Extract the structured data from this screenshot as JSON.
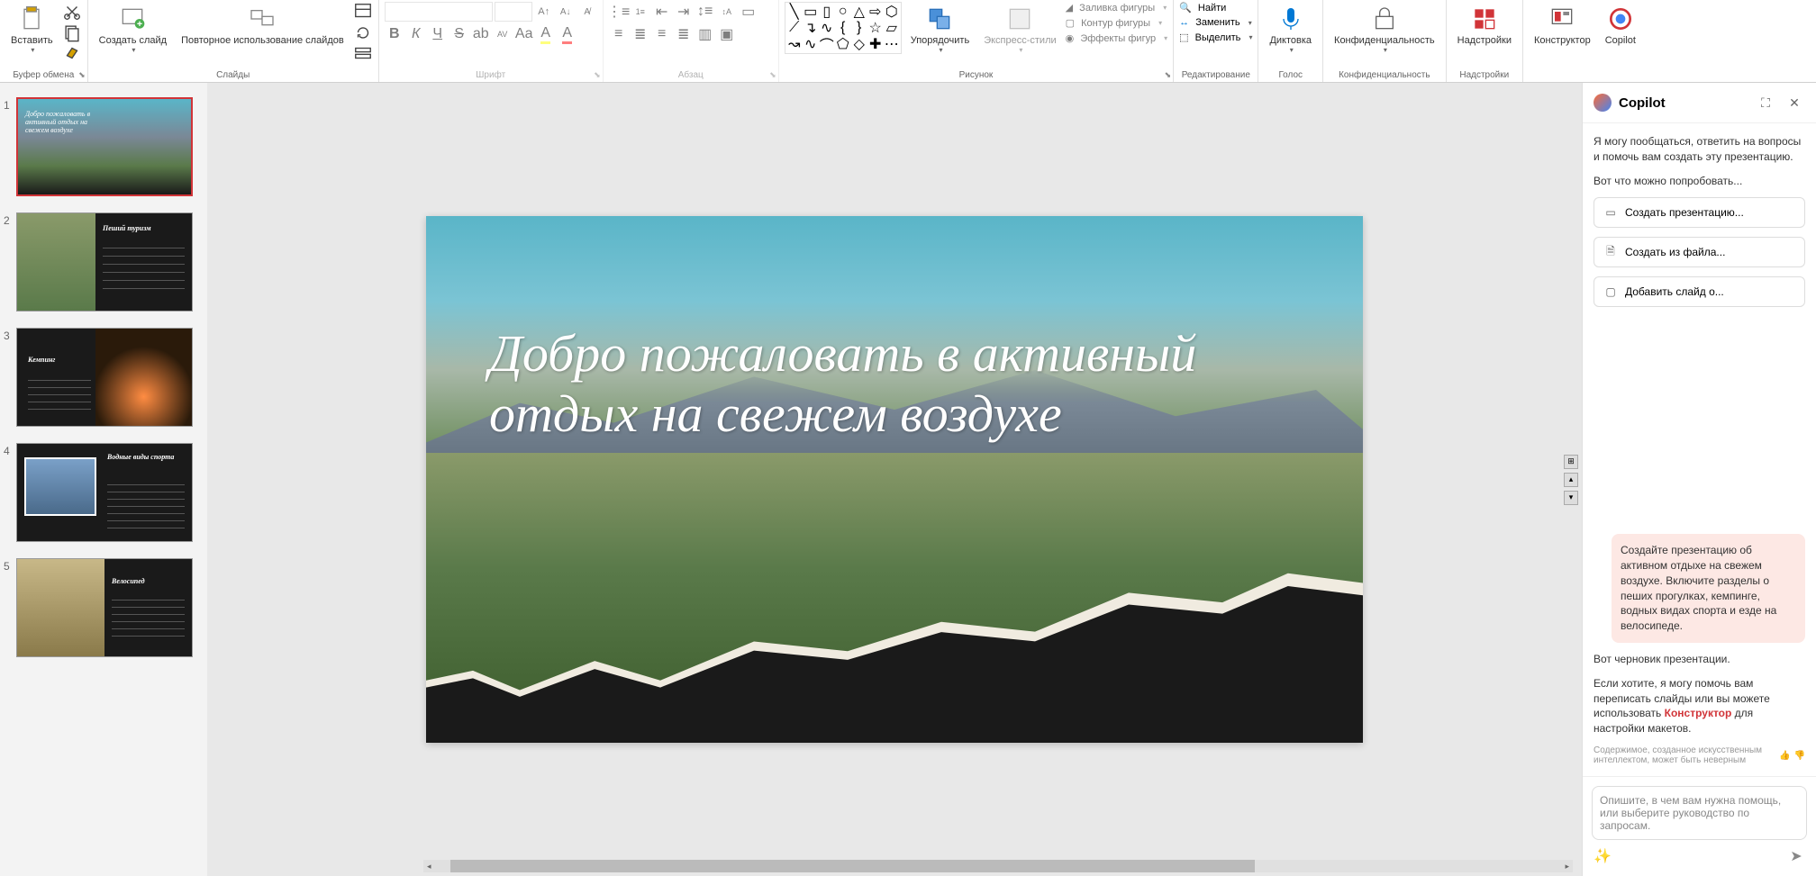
{
  "ribbon": {
    "clipboard": {
      "label": "Буфер обмена",
      "paste": "Вставить"
    },
    "slides": {
      "label": "Слайды",
      "new": "Создать слайд",
      "reuse": "Повторное использование слайдов"
    },
    "font": {
      "label": "Шрифт"
    },
    "para": {
      "label": "Абзац"
    },
    "drawing": {
      "label": "Рисунок",
      "arrange": "Упорядочить",
      "express": "Экспресс-стили",
      "fill": "Заливка фигуры",
      "outline": "Контур фигуры",
      "effects": "Эффекты фигур"
    },
    "editing": {
      "label": "Редактирование",
      "find": "Найти",
      "replace": "Заменить",
      "select": "Выделить"
    },
    "voice": {
      "label": "Голос",
      "dictate": "Диктовка"
    },
    "privacy": {
      "label": "Конфиденциальность",
      "btn": "Конфиденциальность"
    },
    "addins": {
      "label": "Надстройки",
      "btn": "Надстройки"
    },
    "designer": "Конструктор",
    "copilot": "Copilot"
  },
  "slides": [
    {
      "num": "1",
      "title": "Добро пожаловать в активный отдых на свежем воздухе"
    },
    {
      "num": "2",
      "title": "Пеший туризм"
    },
    {
      "num": "3",
      "title": "Кемпинг"
    },
    {
      "num": "4",
      "title": "Водные виды спорта"
    },
    {
      "num": "5",
      "title": "Велосипед"
    }
  ],
  "main_slide": {
    "title": "Добро пожаловать в активный отдых на свежем воздухе"
  },
  "copilot": {
    "title": "Copilot",
    "intro": "Я могу пообщаться, ответить на вопросы и помочь вам создать эту презентацию.",
    "try": "Вот что можно попробовать...",
    "actions": [
      "Создать презентацию...",
      "Создать из файла...",
      "Добавить слайд о..."
    ],
    "user_msg": "Создайте презентацию об активном отдыхе на свежем воздухе. Включите разделы о пеших прогулках, кемпинге, водных видах спорта и езде на велосипеде.",
    "bot1": "Вот черновик презентации.",
    "bot2a": "Если хотите, я могу помочь вам переписать слайды или вы можете использовать ",
    "bot2b": "Конструктор",
    "bot2c": " для настройки макетов.",
    "disclaimer": "Содержимое, созданное искусственным интеллектом, может быть неверным",
    "input_placeholder": "Опишите, в чем вам нужна помощь, или выберите руководство по запросам."
  }
}
